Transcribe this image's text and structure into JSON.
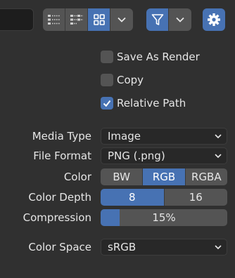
{
  "checkboxes": [
    {
      "label": "Save As Render",
      "checked": false
    },
    {
      "label": "Copy",
      "checked": false
    },
    {
      "label": "Relative Path",
      "checked": true
    }
  ],
  "media_type": {
    "label": "Media Type",
    "value": "Image"
  },
  "file_format": {
    "label": "File Format",
    "value": "PNG (.png)"
  },
  "color": {
    "label": "Color",
    "options": [
      "BW",
      "RGB",
      "RGBA"
    ],
    "selected": "RGB"
  },
  "color_depth": {
    "label": "Color Depth",
    "options": [
      "8",
      "16"
    ],
    "selected": "8"
  },
  "compression": {
    "label": "Compression",
    "value_text": "15%",
    "value": 0.15
  },
  "color_space": {
    "label": "Color Space",
    "value": "sRGB"
  },
  "colors": {
    "accent": "#4772b3",
    "background": "#303030",
    "widget": "#545454",
    "field": "#282828"
  },
  "icons": [
    "vertical-list-icon",
    "horizontal-list-icon",
    "thumbnails-icon",
    "chevron-down-icon",
    "filter-icon",
    "gear-icon",
    "checkmark-icon"
  ]
}
